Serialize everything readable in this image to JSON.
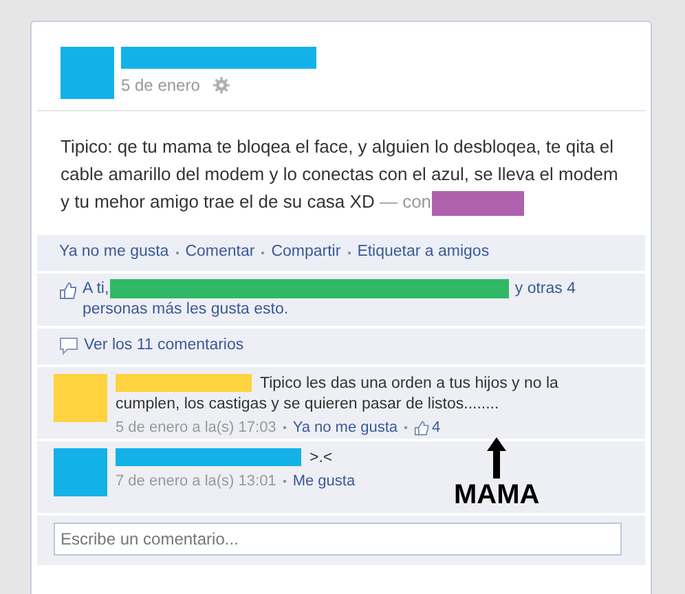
{
  "post": {
    "date": "5 de enero",
    "text": "Tipico: qe tu mama te bloqea el face, y alguien lo desbloqea, te qita el cable amarillo del modem y lo conectas con el azul, se lleva el modem y tu mehor amigo trae el de su casa XD",
    "with_label": "— con"
  },
  "actions": [
    "Ya no me gusta",
    "Comentar",
    "Compartir",
    "Etiquetar a amigos"
  ],
  "likes": {
    "prefix": "A ti,",
    "suffix": "y otras 4 personas más les gusta esto."
  },
  "view_comments": "Ver los 11 comentarios",
  "comments": [
    {
      "text": "Tipico les das una orden a tus hijos y no la cumplen, los castigas y se quieren pasar de listos........",
      "time": "5 de enero a la(s) 17:03",
      "like_link": "Ya no me gusta",
      "like_count": "4"
    },
    {
      "text": ">.<",
      "time": "7 de enero a la(s) 13:01",
      "like_link": "Me gusta"
    }
  ],
  "comment_field": {
    "placeholder": "Escribe un comentario..."
  },
  "annotation": {
    "text": "MAMA"
  }
}
